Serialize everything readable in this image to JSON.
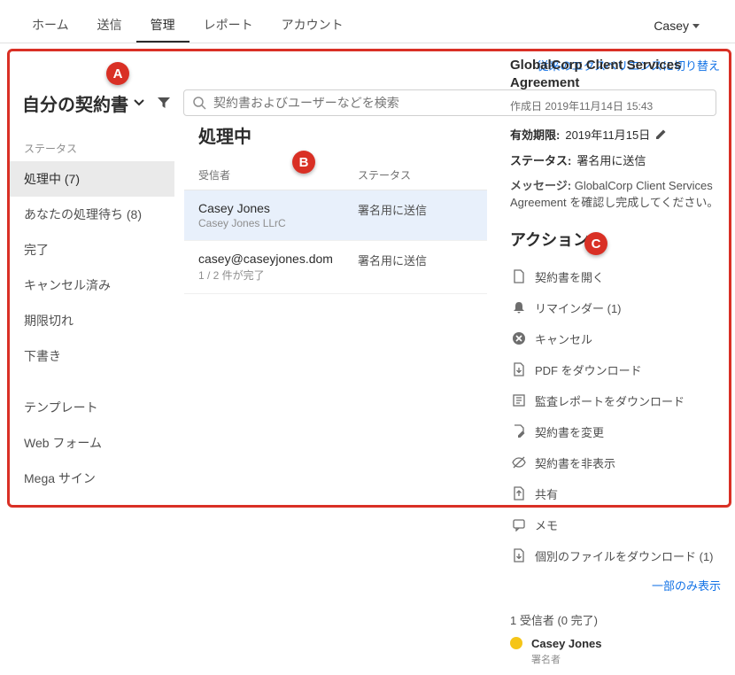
{
  "nav": {
    "items": [
      {
        "label": "ホーム"
      },
      {
        "label": "送信"
      },
      {
        "label": "管理",
        "active": true
      },
      {
        "label": "レポート"
      },
      {
        "label": "アカウント"
      }
    ],
    "user": "Casey"
  },
  "switch_link": "従来のエクスペリエンスに切り替え",
  "page_title": "自分の契約書",
  "search": {
    "placeholder": "契約書およびユーザーなどを検索"
  },
  "sidebar": {
    "heading": "ステータス",
    "items": [
      {
        "label": "処理中 (7)",
        "active": true
      },
      {
        "label": "あなたの処理待ち (8)"
      },
      {
        "label": "完了"
      },
      {
        "label": "キャンセル済み"
      },
      {
        "label": "期限切れ"
      },
      {
        "label": "下書き"
      }
    ],
    "extra": [
      {
        "label": "テンプレート"
      },
      {
        "label": "Web フォーム"
      },
      {
        "label": "Mega サイン"
      }
    ]
  },
  "list": {
    "section_title": "処理中",
    "columns": {
      "recipient": "受信者",
      "status": "ステータス"
    },
    "rows": [
      {
        "title": "Casey Jones",
        "sub": "Casey Jones LLrC",
        "status": "署名用に送信",
        "selected": true
      },
      {
        "title": "casey@caseyjones.dom",
        "sub": "1 / 2 件が完了",
        "status": "署名用に送信"
      }
    ]
  },
  "detail": {
    "title": "GlobalCorp Client Services Agreement",
    "created_label": "作成日",
    "created_value": "2019年11月14日 15:43",
    "expiry_label": "有効期限:",
    "expiry_value": "2019年11月15日",
    "status_label": "ステータス:",
    "status_value": "署名用に送信",
    "message_label": "メッセージ:",
    "message_value": "GlobalCorp Client Services Agreement を確認し完成してください。",
    "actions_title": "アクション",
    "actions": [
      {
        "icon": "document",
        "label": "契約書を開く"
      },
      {
        "icon": "bell",
        "label": "リマインダー (1)"
      },
      {
        "icon": "cancel",
        "label": "キャンセル"
      },
      {
        "icon": "pdf",
        "label": "PDF をダウンロード"
      },
      {
        "icon": "audit",
        "label": "監査レポートをダウンロード"
      },
      {
        "icon": "edit",
        "label": "契約書を変更"
      },
      {
        "icon": "hide",
        "label": "契約書を非表示"
      },
      {
        "icon": "share",
        "label": "共有"
      },
      {
        "icon": "note",
        "label": "メモ"
      },
      {
        "icon": "download",
        "label": "個別のファイルをダウンロード (1)"
      }
    ],
    "show_less": "一部のみ表示",
    "recipient_head": "1 受信者 (0 完了)",
    "recipient": {
      "name": "Casey Jones",
      "role": "署名者"
    }
  },
  "badges": {
    "a": "A",
    "b": "B",
    "c": "C"
  }
}
